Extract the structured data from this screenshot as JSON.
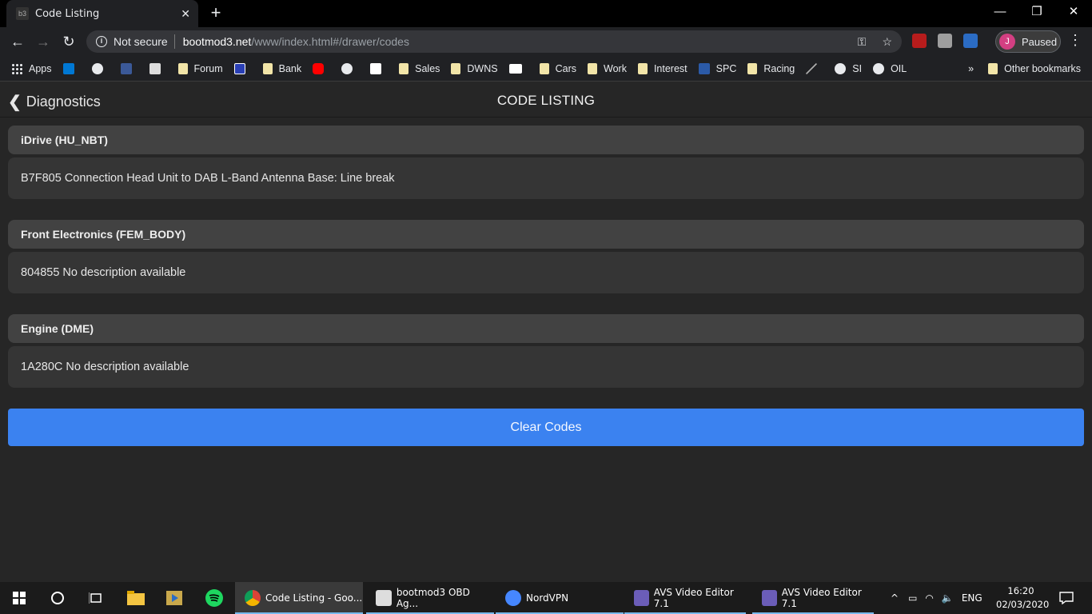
{
  "browser": {
    "tab_title": "Code Listing",
    "tab_close": "✕",
    "new_tab": "+",
    "window_controls": {
      "minimize": "—",
      "restore": "❐",
      "close": "✕"
    },
    "nav": {
      "back": "←",
      "forward": "→",
      "reload": "↻"
    },
    "address": {
      "security_icon": "i",
      "security_label": "Not secure",
      "host": "bootmod3.net",
      "path": "/www/index.html#/drawer/codes"
    },
    "profile": {
      "initial": "J",
      "status": "Paused"
    },
    "menu": "⋮"
  },
  "bookmarks": {
    "items": [
      {
        "label": "Apps",
        "icon": "apps-grid"
      },
      {
        "label": "",
        "icon": "outlook-icon",
        "color": "#0078d4"
      },
      {
        "label": "",
        "icon": "globe-icon",
        "color": "#e8eaed"
      },
      {
        "label": "",
        "icon": "facebook-icon",
        "color": "#3b5998"
      },
      {
        "label": "",
        "icon": "soccer-icon",
        "color": "#dddddd"
      },
      {
        "label": "Forum",
        "icon": "folder"
      },
      {
        "label": "",
        "icon": "parking-icon",
        "color": "#2a3fb5"
      },
      {
        "label": "Bank",
        "icon": "folder"
      },
      {
        "label": "",
        "icon": "youtube-icon",
        "color": "#ff0000"
      },
      {
        "label": "",
        "icon": "globe-icon",
        "color": "#e8eaed"
      },
      {
        "label": "",
        "icon": "amazon-icon",
        "color": "#ffffff"
      },
      {
        "label": "Sales",
        "icon": "folder"
      },
      {
        "label": "DWNS",
        "icon": "folder"
      },
      {
        "label": "",
        "icon": "page-icon",
        "color": "#ffffff"
      },
      {
        "label": "Cars",
        "icon": "folder"
      },
      {
        "label": "Work",
        "icon": "folder"
      },
      {
        "label": "Interest",
        "icon": "folder"
      },
      {
        "label": "SPC",
        "icon": "amazon-a-icon",
        "color": "#2b5aa8"
      },
      {
        "label": "Racing",
        "icon": "folder"
      },
      {
        "label": "",
        "icon": "pen-icon",
        "color": "#aaaaaa"
      },
      {
        "label": "SI",
        "icon": "globe-icon",
        "color": "#e8eaed"
      },
      {
        "label": "OIL",
        "icon": "globe-icon",
        "color": "#e8eaed"
      }
    ],
    "overflow": "»",
    "other": "Other bookmarks"
  },
  "app": {
    "back_label": "Diagnostics",
    "title": "CODE LISTING",
    "groups": [
      {
        "module": "iDrive (HU_NBT)",
        "code": "B7F805 Connection Head Unit to DAB L-Band Antenna Base: Line break"
      },
      {
        "module": "Front Electronics (FEM_BODY)",
        "code": "804855 No description available"
      },
      {
        "module": "Engine (DME)",
        "code": "1A280C No description available"
      }
    ],
    "clear_button": "Clear Codes",
    "accent": "#3b82f0"
  },
  "taskbar": {
    "tasks": [
      {
        "label": "Code Listing - Goo...",
        "icon": "chrome-icon",
        "active": true
      },
      {
        "label": "bootmod3 OBD Ag...",
        "icon": "java-icon",
        "active": false
      },
      {
        "label": "NordVPN",
        "icon": "nordvpn-icon",
        "active": false
      },
      {
        "label": "AVS Video Editor 7.1",
        "icon": "avs-icon",
        "active": false
      },
      {
        "label": "AVS Video Editor 7.1",
        "icon": "avs-icon",
        "active": false
      }
    ],
    "language": "ENG",
    "time": "16:20",
    "date": "02/03/2020"
  }
}
